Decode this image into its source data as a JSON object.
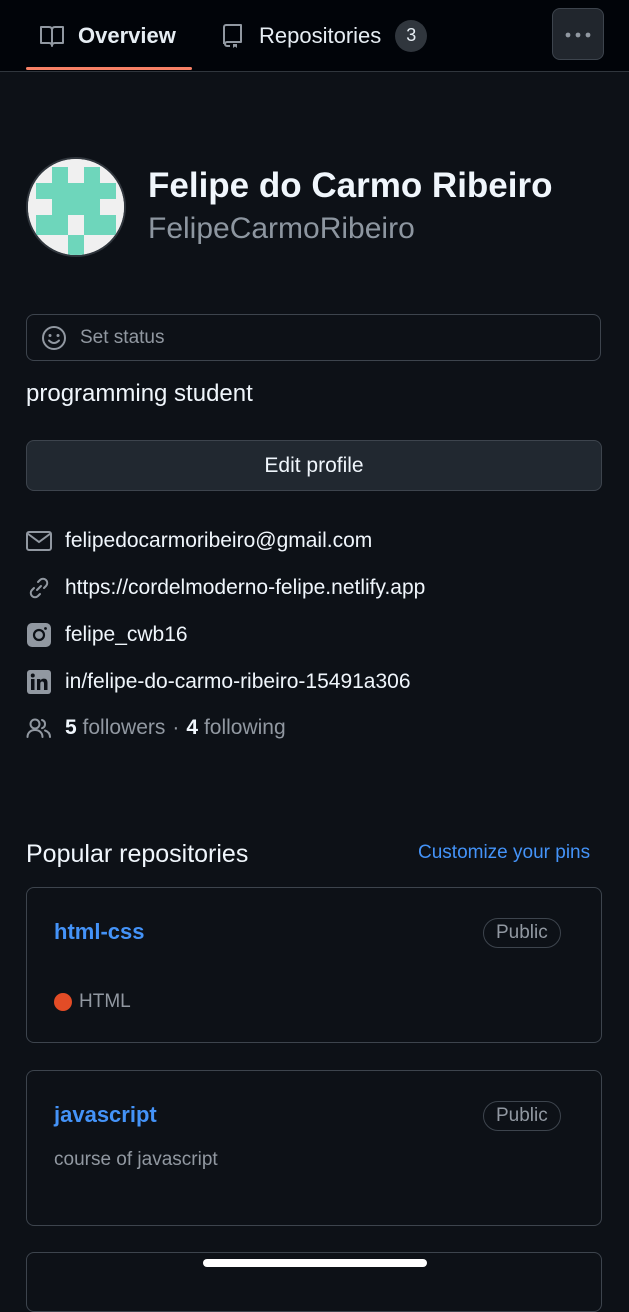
{
  "nav": {
    "tabs": [
      {
        "label": "Overview",
        "icon": "book-icon",
        "selected": true
      },
      {
        "label": "Repositories",
        "icon": "repo-icon",
        "count": "3"
      }
    ],
    "more_icon": "kebab-horizontal-icon",
    "underline_color": "#f78166"
  },
  "profile": {
    "name": "Felipe do Carmo Ribeiro",
    "login": "FelipeCarmoRibeiro",
    "status_label": "Set status",
    "bio": "programming student",
    "edit_label": "Edit profile",
    "avatar_colors": {
      "pixel": "#6ed6bb",
      "background": "#f0f0f0"
    }
  },
  "details": {
    "email": "felipedocarmoribeiro@gmail.com",
    "website": "https://cordelmoderno-felipe.netlify.app",
    "instagram": "felipe_cwb16",
    "linkedin": "in/felipe-do-carmo-ribeiro-15491a306",
    "followers_count": "5",
    "followers_label": "followers",
    "separator": "·",
    "following_count": "4",
    "following_label": "following"
  },
  "popular": {
    "title": "Popular repositories",
    "customize_label": "Customize your pins",
    "repos": [
      {
        "name": "html-css",
        "visibility": "Public",
        "language": "HTML",
        "language_color": "#e34c26"
      },
      {
        "name": "javascript",
        "visibility": "Public",
        "description": "course of javascript"
      }
    ]
  },
  "colors": {
    "background": "#0d1117",
    "link": "#4493f8",
    "muted": "#9198a1"
  }
}
